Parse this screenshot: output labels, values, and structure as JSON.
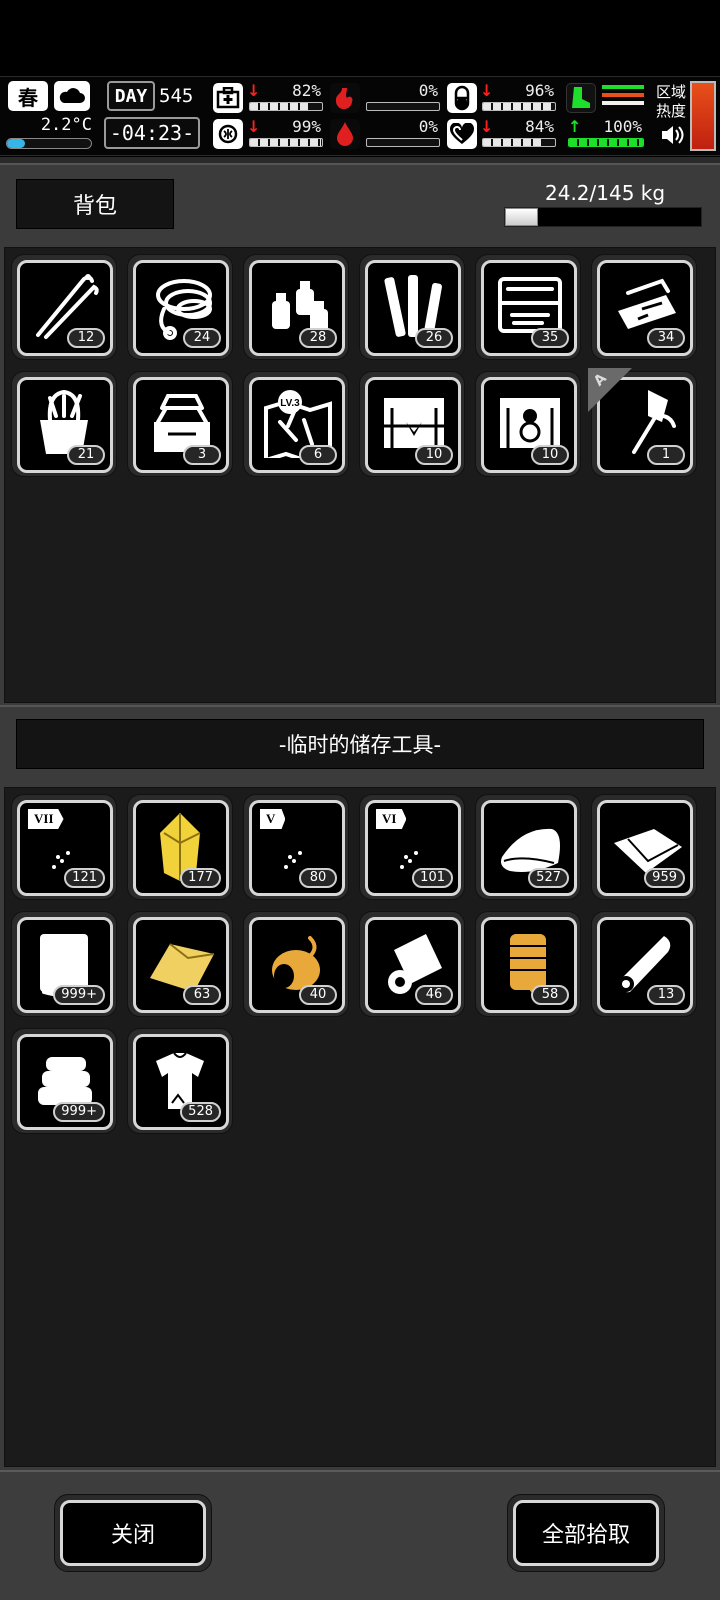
{
  "hud": {
    "season": "春",
    "day_label": "DAY",
    "day_number": "545",
    "temperature": "2.2°C",
    "temperature_level": 0.22,
    "time": "-04:23-",
    "stats": [
      {
        "name": "health",
        "icon": "first-aid-icon",
        "value": "82%",
        "level": 0.82,
        "trend": "down"
      },
      {
        "name": "brain",
        "icon": "brain-icon",
        "value": "99%",
        "level": 0.99,
        "trend": "down"
      },
      {
        "name": "hunger",
        "icon": "stomach-icon",
        "value": "0%",
        "level": 0.0,
        "trend": "none"
      },
      {
        "name": "thirst",
        "icon": "water-drop-icon",
        "value": "0%",
        "level": 0.0,
        "trend": "none"
      },
      {
        "name": "stamina",
        "icon": "pill-icon",
        "value": "96%",
        "level": 0.96,
        "trend": "down"
      },
      {
        "name": "mood",
        "icon": "heart-icon",
        "value": "84%",
        "level": 0.84,
        "trend": "down"
      },
      {
        "name": "energy",
        "icon": "boot-icon",
        "value": "100%",
        "level": 1.0,
        "trend": "up"
      }
    ],
    "zone_heat_label_1": "区域",
    "zone_heat_label_2": "热度",
    "colors": {
      "alert": "#ff2020",
      "good": "#1ee02a",
      "heat": "#e8501a"
    }
  },
  "backpack": {
    "title": "背包",
    "weight": "24.2/145 kg",
    "weight_level": 0.167,
    "items": [
      {
        "icon": "lockpick-icon",
        "count": "12"
      },
      {
        "icon": "rope-icon",
        "count": "24"
      },
      {
        "icon": "spray-bottles-icon",
        "count": "28"
      },
      {
        "icon": "tubes-icon",
        "count": "26"
      },
      {
        "icon": "toolbox-open-icon",
        "count": "35"
      },
      {
        "icon": "tool-case-icon",
        "count": "34"
      },
      {
        "icon": "tool-bucket-icon",
        "count": "21"
      },
      {
        "icon": "tackle-box-icon",
        "count": "3"
      },
      {
        "icon": "map-lv3-icon",
        "count": "6",
        "badge": "LV.3"
      },
      {
        "icon": "ammo-crate-icon",
        "count": "10"
      },
      {
        "icon": "money-crate-icon",
        "count": "10"
      },
      {
        "icon": "axe-icon",
        "count": "1",
        "corner": "A"
      }
    ]
  },
  "storage": {
    "title": "-临时的储存工具-",
    "items": [
      {
        "icon": "test-tube-icon",
        "count": "121",
        "tag": "VII",
        "color": "#ffffff"
      },
      {
        "icon": "crystal-icon",
        "count": "177",
        "color": "#f2d23a"
      },
      {
        "icon": "test-tube-icon",
        "count": "80",
        "tag": "V",
        "color": "#ffffff"
      },
      {
        "icon": "test-tube-icon",
        "count": "101",
        "tag": "VI",
        "color": "#ffffff"
      },
      {
        "icon": "cloth-icon",
        "count": "527",
        "color": "#ffffff"
      },
      {
        "icon": "folded-cloth-icon",
        "count": "959",
        "color": "#ffffff"
      },
      {
        "icon": "sheet-icon",
        "count": "999+",
        "color": "#ffffff"
      },
      {
        "icon": "yellow-sheet-icon",
        "count": "63",
        "color": "#f0d060"
      },
      {
        "icon": "thread-spool-icon",
        "count": "40",
        "color": "#e8a93a"
      },
      {
        "icon": "paper-roll-icon",
        "count": "46",
        "color": "#ffffff"
      },
      {
        "icon": "tape-roll-icon",
        "count": "58",
        "color": "#e8a93a"
      },
      {
        "icon": "rolled-fabric-icon",
        "count": "13",
        "color": "#ffffff"
      },
      {
        "icon": "towel-stack-icon",
        "count": "999+",
        "color": "#ffffff"
      },
      {
        "icon": "torn-shirt-icon",
        "count": "528",
        "color": "#ffffff"
      }
    ]
  },
  "footer": {
    "close_label": "关闭",
    "take_all_label": "全部拾取"
  }
}
